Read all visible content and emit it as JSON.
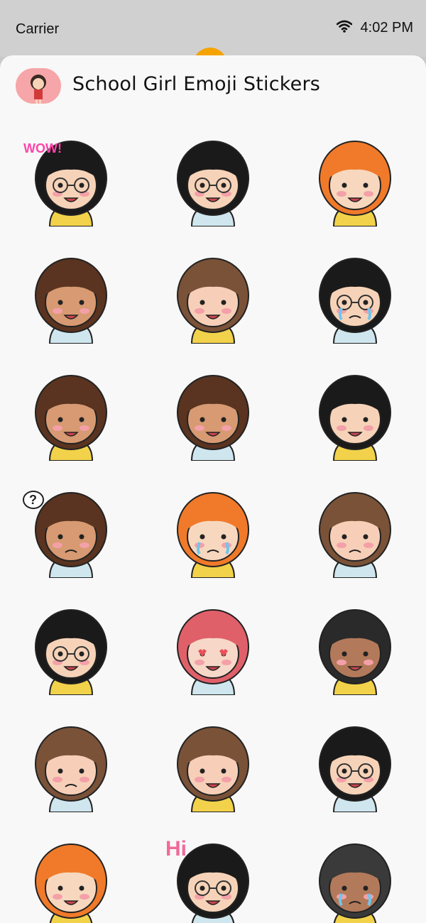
{
  "status_bar": {
    "carrier": "Carrier",
    "time": "4:02 PM"
  },
  "app": {
    "title": "School Girl Emoji Stickers"
  },
  "colors": {
    "peek_accent": "#f5a300",
    "icon_bg": "#f6a6a8"
  },
  "stickers": [
    {
      "icon": "wow-girl-glasses",
      "hair": "#1a1a1a",
      "text": "WOW!",
      "textColor": "#f4a"
    },
    {
      "icon": "smiling-girl-glasses",
      "hair": "#1a1a1a",
      "text": ""
    },
    {
      "icon": "ginger-girl-waving",
      "hair": "#f07a2a",
      "text": ""
    },
    {
      "icon": "girl-heart-hands",
      "hair": "#5a3420",
      "text": ""
    },
    {
      "icon": "brown-hair-staring",
      "hair": "#7a5238",
      "text": ""
    },
    {
      "icon": "crying-girl-glasses",
      "hair": "#1a1a1a",
      "text": ""
    },
    {
      "icon": "girl-eating-burger",
      "hair": "#5a3420",
      "text": ""
    },
    {
      "icon": "sleepy-girl",
      "hair": "#5a3420",
      "text": ""
    },
    {
      "icon": "peace-sign-girl",
      "hair": "#1a1a1a",
      "text": ""
    },
    {
      "icon": "confused-girl-question",
      "hair": "#5a3420",
      "text": "?"
    },
    {
      "icon": "ginger-girl-crying",
      "hair": "#f07a2a",
      "text": ""
    },
    {
      "icon": "sweating-girl",
      "hair": "#7a5238",
      "text": ""
    },
    {
      "icon": "laughing-girl-glasses",
      "hair": "#1a1a1a",
      "text": ""
    },
    {
      "icon": "heart-eyes-girl",
      "hair": "#e0606a",
      "text": ""
    },
    {
      "icon": "girl-covering-face",
      "hair": "#2a2a2a",
      "text": ""
    },
    {
      "icon": "eye-roll-girl",
      "hair": "#7a5238",
      "text": ""
    },
    {
      "icon": "big-grin-girl",
      "hair": "#7a5238",
      "text": ""
    },
    {
      "icon": "excited-girl-glasses",
      "hair": "#1a1a1a",
      "text": ""
    },
    {
      "icon": "drooling-ginger-girl",
      "hair": "#f07a2a",
      "text": ""
    },
    {
      "icon": "hi-girl-glasses",
      "hair": "#1a1a1a",
      "text": "Hi",
      "textColor": "#f06a9a"
    },
    {
      "icon": "sobbing-girl",
      "hair": "#3a3a3a",
      "text": ""
    }
  ]
}
